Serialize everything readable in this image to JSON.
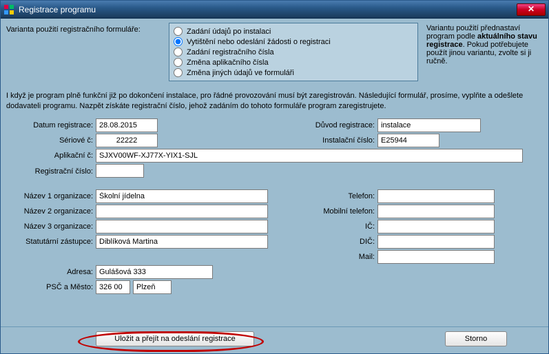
{
  "window": {
    "title": "Registrace programu"
  },
  "variant": {
    "label": "Varianta použití registračního formuláře:",
    "options": [
      "Zadání údajů po instalaci",
      "Vytištění nebo odeslání žádosti o registraci",
      "Zadání registračního čísla",
      "Změna aplikačního čísla",
      "Změna jiných údajů ve formuláři"
    ],
    "selected": 1,
    "desc_pre": "Variantu použití přednastaví program podle ",
    "desc_bold": "aktuálního stavu registrace",
    "desc_post": ". Pokud potřebujete použít jinou variantu, zvolte si ji ručně."
  },
  "paragraph": "I když je program plně funkční již po dokončení instalace, pro řádné provozování musí být zaregistrován. Následující formulář, prosíme, vyplňte a odešlete dodavateli programu. Nazpět získáte registrační číslo, jehož zadáním do tohoto formuláře program zaregistrujete.",
  "labels": {
    "datum": "Datum registrace:",
    "duvod": "Důvod registrace:",
    "seriove": "Sériové č:",
    "instalacni": "Instalační číslo:",
    "aplikacni": "Aplikační č:",
    "registracni": "Registrační číslo:",
    "nazev1": "Název 1 organizace:",
    "nazev2": "Název 2 organizace:",
    "nazev3": "Název 3 organizace:",
    "statutar": "Statutární zástupce:",
    "adresa": "Adresa:",
    "psc": "PSČ a Město:",
    "telefon": "Telefon:",
    "mobil": "Mobilní telefon:",
    "ic": "IČ:",
    "dic": "DIČ:",
    "mail": "Mail:"
  },
  "values": {
    "datum": "28.08.2015",
    "duvod": "instalace",
    "seriove": "22222",
    "instalacni": "E25944",
    "aplikacni": "SJXV00WF-XJ77X-YIX1-SJL",
    "registracni": "",
    "nazev1": "Školní jídelna",
    "nazev2": "",
    "nazev3": "",
    "statutar": "Diblíková Martina",
    "adresa": "Gulášová 333",
    "psc": "326 00",
    "mesto": "Plzeň",
    "telefon": "",
    "mobil": "",
    "ic": "",
    "dic": "",
    "mail": ""
  },
  "buttons": {
    "save": "Uložit a přejít na odeslání registrace",
    "storno": "Storno"
  }
}
